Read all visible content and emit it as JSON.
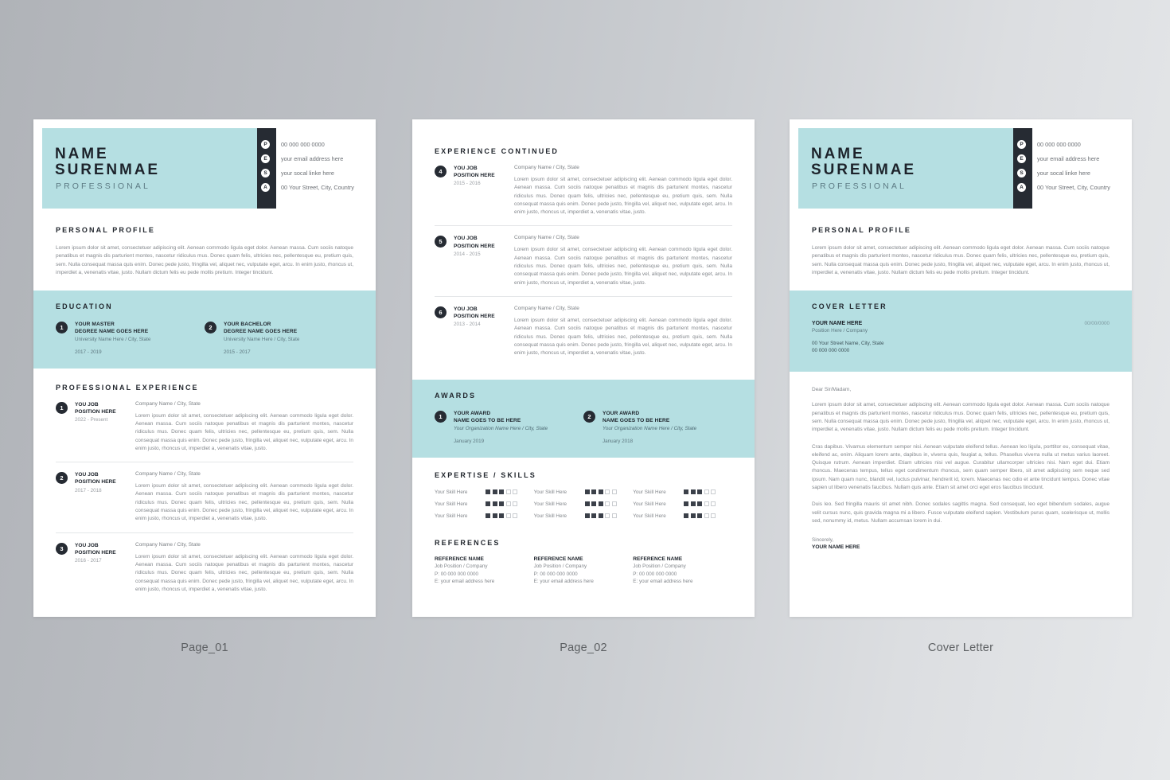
{
  "page_labels": {
    "page1": "Page_01",
    "page2": "Page_02",
    "page3": "Cover Letter"
  },
  "colors": {
    "teal": "#b5dfe2",
    "dark": "#262b33",
    "body_text": "#83878c"
  },
  "header": {
    "name_line1": "NAME",
    "name_line2": "SURENMAE",
    "role": "PROFESSIONAL",
    "contacts": [
      {
        "badge": "P",
        "icon": "phone-icon",
        "text": "00 000 000 0000"
      },
      {
        "badge": "E",
        "icon": "email-icon",
        "text": "your email address here"
      },
      {
        "badge": "S",
        "icon": "social-icon",
        "text": "your socal linke here"
      },
      {
        "badge": "A",
        "icon": "address-icon",
        "text": "00 Your Street, City, Country"
      }
    ]
  },
  "personal_profile": {
    "title": "PERSONAL PROFILE",
    "text": "Lorem ipsum dolor sit amet, consectetuer adipiscing elit. Aenean commodo ligula eget dolor. Aenean massa. Cum sociis natoque penatibus et magnis dis parturient montes, nascetur ridiculus mus. Donec quam felis, ultricies nec, pellentesque eu, pretium quis, sem. Nulla consequat massa quis enim. Donec pede justo, fringilla vel, aliquet nec, vulputate eget, arcu. In enim justo, rhoncus ut, imperdiet a, venenatis vitae, justo. Nullam dictum felis eu pede mollis pretium. Integer tincidunt."
  },
  "education": {
    "title": "EDUCATION",
    "items": [
      {
        "num": "1",
        "line1": "YOUR MASTER",
        "line2": "DEGREE NAME GOES HERE",
        "sub": "University Name Here / City, State",
        "date": "2017 - 2019"
      },
      {
        "num": "2",
        "line1": "YOUR BACHELOR",
        "line2": "DEGREE NAME GOES HERE",
        "sub": "University Name Here / City, State",
        "date": "2015 - 2017"
      }
    ]
  },
  "professional_experience": {
    "title": "PROFESSIONAL EXPERIENCE",
    "items": [
      {
        "num": "1",
        "line1": "YOU JOB",
        "line2": "POSITION HERE",
        "date": "2022 - Present",
        "company": "Company Name / City, State",
        "text": "Lorem ipsum dolor sit amet, consectetuer adipiscing elit. Aenean commodo ligula eget dolor. Aenean massa. Cum sociis natoque penatibus et magnis dis parturient montes, nascetur ridiculus mus. Donec quam felis, ultricies nec, pellentesque eu, pretium quis, sem. Nulla consequat massa quis enim. Donec pede justo, fringilla vel, aliquet nec, vulputate eget, arcu. In enim justo, rhoncus ut, imperdiet a, venenatis vitae, justo."
      },
      {
        "num": "2",
        "line1": "YOU JOB",
        "line2": "POSITION HERE",
        "date": "2017 - 2018",
        "company": "Company Name / City, State",
        "text": "Lorem ipsum dolor sit amet, consectetuer adipiscing elit. Aenean commodo ligula eget dolor. Aenean massa. Cum sociis natoque penatibus et magnis dis parturient montes, nascetur ridiculus mus. Donec quam felis, ultricies nec, pellentesque eu, pretium quis, sem. Nulla consequat massa quis enim. Donec pede justo, fringilla vel, aliquet nec, vulputate eget, arcu. In enim justo, rhoncus ut, imperdiet a, venenatis vitae, justo."
      },
      {
        "num": "3",
        "line1": "YOU JOB",
        "line2": "POSITION HERE",
        "date": "2016 - 2017",
        "company": "Company Name / City, State",
        "text": "Lorem ipsum dolor sit amet, consectetuer adipiscing elit. Aenean commodo ligula eget dolor. Aenean massa. Cum sociis natoque penatibus et magnis dis parturient montes, nascetur ridiculus mus. Donec quam felis, ultricies nec, pellentesque eu, pretium quis, sem. Nulla consequat massa quis enim. Donec pede justo, fringilla vel, aliquet nec, vulputate eget, arcu. In enim justo, rhoncus ut, imperdiet a, venenatis vitae, justo."
      }
    ]
  },
  "experience_continued": {
    "title": "EXPERIENCE CONTINUED",
    "items": [
      {
        "num": "4",
        "line1": "YOU JOB",
        "line2": "POSITION HERE",
        "date": "2015 - 2016",
        "company": "Company Name / City, State",
        "text": "Lorem ipsum dolor sit amet, consectetuer adipiscing elit. Aenean commodo ligula eget dolor. Aenean massa. Cum sociis natoque penatibus et magnis dis parturient montes, nascetur ridiculus mus. Donec quam felis, ultricies nec, pellentesque eu, pretium quis, sem. Nulla consequat massa quis enim. Donec pede justo, fringilla vel, aliquet nec, vulputate eget, arcu. In enim justo, rhoncus ut, imperdiet a, venenatis vitae, justo."
      },
      {
        "num": "5",
        "line1": "YOU JOB",
        "line2": "POSITION HERE",
        "date": "2014 - 2015",
        "company": "Company Name / City, State",
        "text": "Lorem ipsum dolor sit amet, consectetuer adipiscing elit. Aenean commodo ligula eget dolor. Aenean massa. Cum sociis natoque penatibus et magnis dis parturient montes, nascetur ridiculus mus. Donec quam felis, ultricies nec, pellentesque eu, pretium quis, sem. Nulla consequat massa quis enim. Donec pede justo, fringilla vel, aliquet nec, vulputate eget, arcu. In enim justo, rhoncus ut, imperdiet a, venenatis vitae, justo."
      },
      {
        "num": "6",
        "line1": "YOU JOB",
        "line2": "POSITION HERE",
        "date": "2013 - 2014",
        "company": "Company Name / City, State",
        "text": "Lorem ipsum dolor sit amet, consectetuer adipiscing elit. Aenean commodo ligula eget dolor. Aenean massa. Cum sociis natoque penatibus et magnis dis parturient montes, nascetur ridiculus mus. Donec quam felis, ultricies nec, pellentesque eu, pretium quis, sem. Nulla consequat massa quis enim. Donec pede justo, fringilla vel, aliquet nec, vulputate eget, arcu. In enim justo, rhoncus ut, imperdiet a, venenatis vitae, justo."
      }
    ]
  },
  "awards": {
    "title": "AWARDS",
    "items": [
      {
        "num": "1",
        "line1": "YOUR AWARD",
        "line2": "NAME GOES TO BE HERE",
        "sub": "Your Organization Name Here / City, State",
        "date": "January 2019"
      },
      {
        "num": "2",
        "line1": "YOUR AWARD",
        "line2": "NAME GOES TO BE HERE",
        "sub": "Your Organization Name Here / City, State",
        "date": "January 2018"
      }
    ]
  },
  "skills": {
    "title": "EXPERTISE / SKILLS",
    "max_rating": 5,
    "items": [
      {
        "name": "Your Skill Here",
        "rating": 3
      },
      {
        "name": "Your Skill Here",
        "rating": 3
      },
      {
        "name": "Your Skill Here",
        "rating": 3
      },
      {
        "name": "Your Skill Here",
        "rating": 3
      },
      {
        "name": "Your Skill Here",
        "rating": 3
      },
      {
        "name": "Your Skill Here",
        "rating": 3
      },
      {
        "name": "Your Skill Here",
        "rating": 3
      },
      {
        "name": "Your Skill Here",
        "rating": 3
      },
      {
        "name": "Your Skill Here",
        "rating": 3
      }
    ]
  },
  "references": {
    "title": "REFERENCES",
    "items": [
      {
        "name": "REFERENCE NAME",
        "position": "Job Position / Company",
        "phone": "P: 00 000 000 0000",
        "email": "E: your email address here"
      },
      {
        "name": "REFERENCE NAME",
        "position": "Job Position / Company",
        "phone": "P: 00 000 000 0000",
        "email": "E: your email address here"
      },
      {
        "name": "REFERENCE NAME",
        "position": "Job Position / Company",
        "phone": "P: 00 000 000 0000",
        "email": "E: your email address here"
      }
    ]
  },
  "cover_letter": {
    "title": "COVER LETTER",
    "sender_name": "YOUR NAME HERE",
    "sender_position": "Position Here / Company",
    "sender_address": "00 Your Street Name, City, State",
    "sender_phone": "00 000 000 0000",
    "date": "00/00/0000",
    "salutation": "Dear Sir/Madam,",
    "paragraphs": [
      "Lorem ipsum dolor sit amet, consectetuer adipiscing elit. Aenean commodo ligula eget dolor. Aenean massa. Cum sociis natoque penatibus et magnis dis parturient montes, nascetur ridiculus mus. Donec quam felis, ultricies nec, pellentesque eu, pretium quis, sem. Nulla consequat massa quis enim. Donec pede justo, fringilla vel, aliquet nec, vulputate eget, arcu. In enim justo, rhoncus ut, imperdiet a, venenatis vitae, justo. Nullam dictum felis eu pede mollis pretium. Integer tincidunt.",
      "Cras dapibus. Vivamus elementum semper nisi. Aenean vulputate eleifend tellus. Aenean leo ligula, porttitor eu, consequat vitae, eleifend ac, enim. Aliquam lorem ante, dapibus in, viverra quis, feugiat a, tellus. Phasellus viverra nulla ut metus varius laoreet. Quisque rutrum. Aenean imperdiet. Etiam ultricies nisi vel augue. Curabitur ullamcorper ultricies nisi. Nam eget dui. Etiam rhoncus. Maecenas tempus, tellus eget condimentum rhoncus, sem quam semper libero, sit amet adipiscing sem neque sed ipsum. Nam quam nunc, blandit vel, luctus pulvinar, hendrerit id, lorem. Maecenas nec odio et ante tincidunt tempus. Donec vitae sapien ut libero venenatis faucibus. Nullam quis ante. Etiam sit amet orci eget eros faucibus tincidunt.",
      "Duis leo. Sed fringilla mauris sit amet nibh. Donec sodales sagittis magna. Sed consequat, leo eget bibendum sodales, augue velit cursus nunc, quis gravida magna mi a libero. Fusce vulputate eleifend sapien. Vestibulum purus quam, scelerisque ut, mollis sed, nonummy id, metus. Nullam accumsan lorem in dui."
    ],
    "closing": "Sincerely,",
    "signature": "YOUR NAME HERE"
  }
}
